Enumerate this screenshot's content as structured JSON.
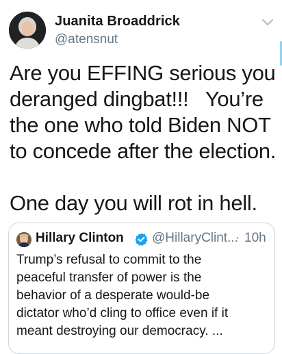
{
  "tweet": {
    "display_name": "Juanita Broaddrick",
    "handle": "@atensnut",
    "avatar_icon": "profile-photo",
    "text_lines": [
      "Are you EFFING serious you",
      "deranged dingbat!!!   You’re",
      "the one who told Biden NOT",
      "to concede after the election."
    ],
    "text_lines_2": [
      "One day you will rot in hell."
    ]
  },
  "quoted_tweet": {
    "display_name": "Hillary Clinton",
    "verified_icon": "verified-badge",
    "handle": "@HillaryClint...",
    "separator": "·",
    "time": "10h",
    "text_lines": [
      "Trump’s refusal to commit to the",
      "peaceful transfer of power is the",
      "behavior of a desperate would-be",
      "dictator who’d cling to office even if it",
      "meant destroying our democracy. ..."
    ]
  },
  "colors": {
    "text": "#14171a",
    "secondary": "#657786",
    "border": "#ccd6dd",
    "verified": "#1da1f2"
  }
}
